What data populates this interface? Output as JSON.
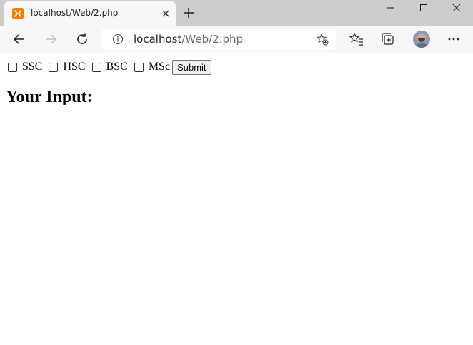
{
  "browser": {
    "tab": {
      "title": "localhost/Web/2.php",
      "favicon": "xampp-icon"
    },
    "address": {
      "host": "localhost",
      "path": "/Web/2.php"
    },
    "accent_tab_icon": "#f57c00"
  },
  "page": {
    "form": {
      "options": [
        {
          "label": "SSC",
          "checked": false
        },
        {
          "label": "HSC",
          "checked": false
        },
        {
          "label": "BSC",
          "checked": false
        },
        {
          "label": "MSc",
          "checked": false
        }
      ],
      "submit_label": "Submit"
    },
    "heading": "Your Input:"
  }
}
